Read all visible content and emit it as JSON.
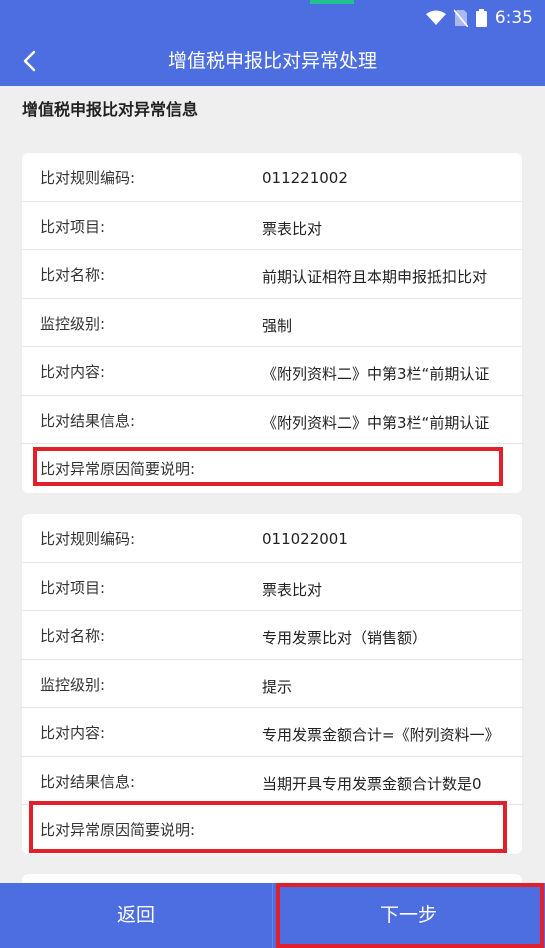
{
  "status_bar": {
    "time": "6:35"
  },
  "nav": {
    "title": "增值税申报比对异常处理"
  },
  "section_title": "增值税申报比对异常信息",
  "cards": [
    {
      "rows": [
        {
          "label": "比对规则编码:",
          "value": "011221002"
        },
        {
          "label": "比对项目:",
          "value": "票表比对"
        },
        {
          "label": "比对名称:",
          "value": "前期认证相符且本期申报抵扣比对"
        },
        {
          "label": "监控级别:",
          "value": "强制"
        },
        {
          "label": "比对内容:",
          "value": "《附列资料二》中第3栏“前期认证"
        },
        {
          "label": "比对结果信息:",
          "value": "《附列资料二》中第3栏“前期认证"
        },
        {
          "label": "比对异常原因简要说明:",
          "value": ""
        }
      ]
    },
    {
      "rows": [
        {
          "label": "比对规则编码:",
          "value": "011022001"
        },
        {
          "label": "比对项目:",
          "value": "票表比对"
        },
        {
          "label": "比对名称:",
          "value": "专用发票比对（销售额）"
        },
        {
          "label": "监控级别:",
          "value": "提示"
        },
        {
          "label": "比对内容:",
          "value": "专用发票金额合计=《附列资料一》"
        },
        {
          "label": "比对结果信息:",
          "value": "当期开具专用发票金额合计数是0"
        },
        {
          "label": "比对异常原因简要说明:",
          "value": ""
        }
      ]
    }
  ],
  "bottom": {
    "back_label": "返回",
    "next_label": "下一步"
  },
  "colors": {
    "primary": "#4c6ee0",
    "highlight": "#e2202c",
    "accent": "#22c28f"
  }
}
